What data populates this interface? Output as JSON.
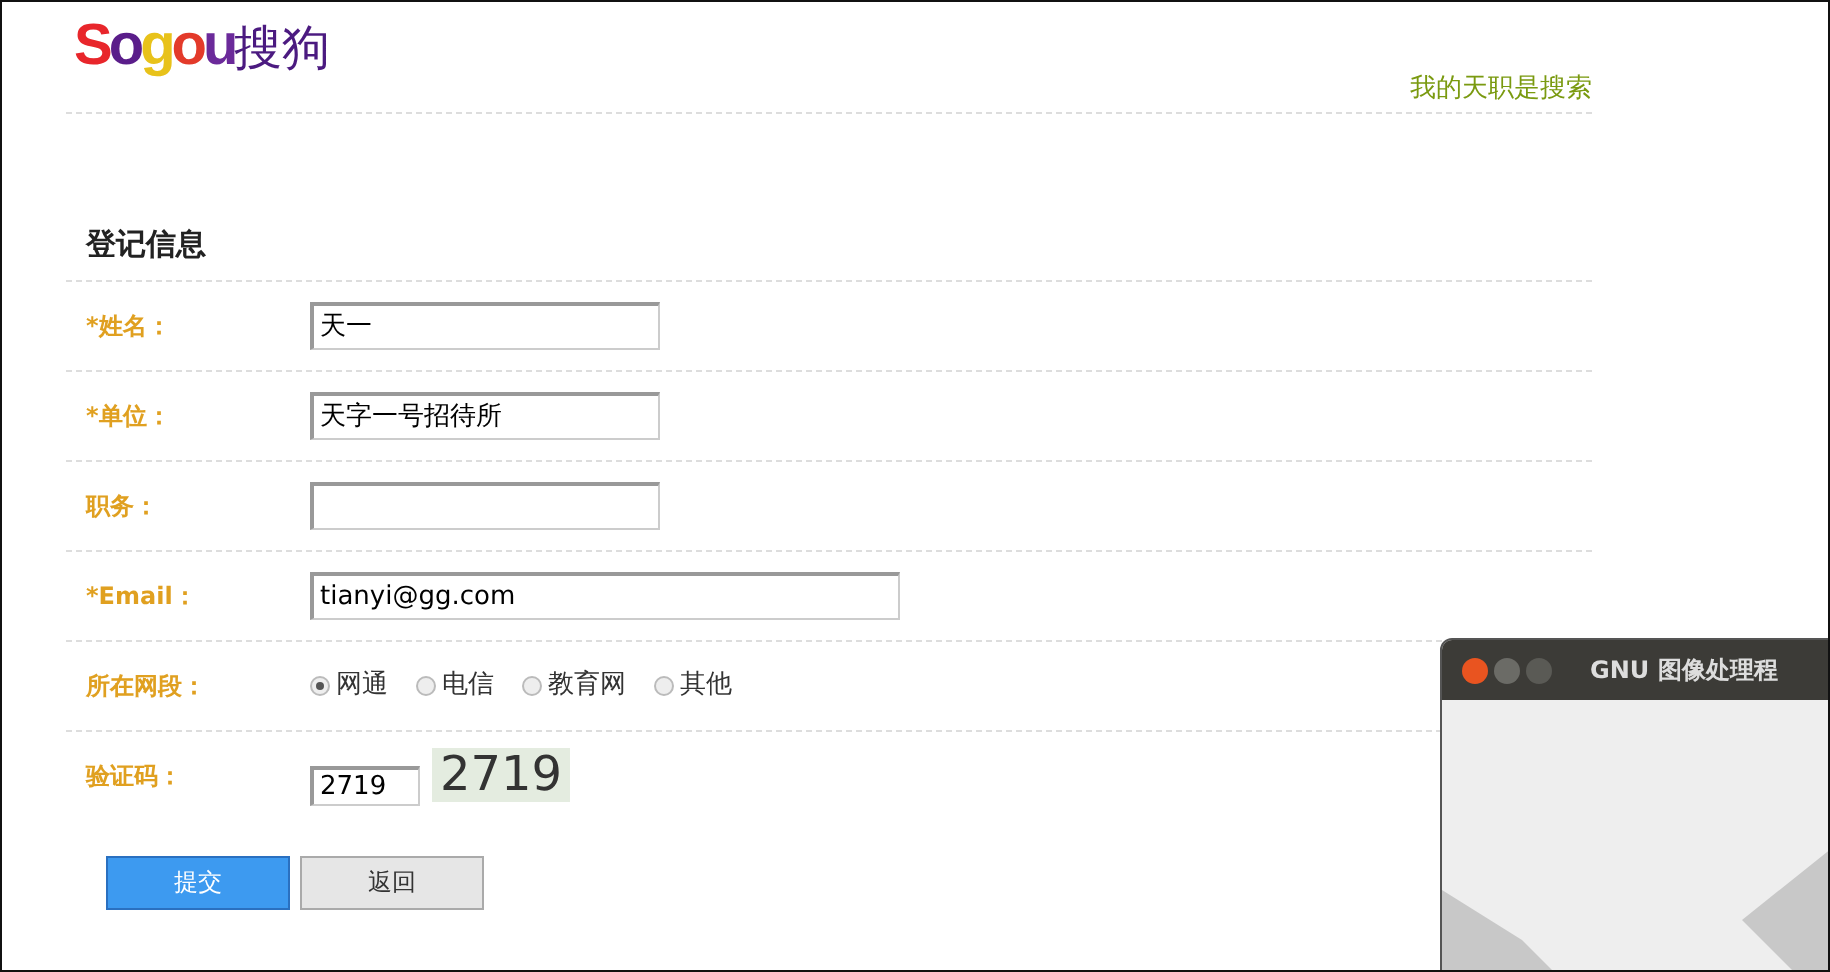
{
  "header": {
    "logo_latin": "Sogou",
    "logo_cjk": "搜狗",
    "slogan": "我的天职是搜索"
  },
  "form": {
    "title": "登记信息",
    "fields": [
      {
        "kind": "text",
        "label": "*姓名：",
        "value": "天一",
        "wide": false
      },
      {
        "kind": "text",
        "label": "*单位：",
        "value": "天字一号招待所",
        "wide": false
      },
      {
        "kind": "text",
        "label": "职务：",
        "wide": false
      },
      {
        "kind": "text",
        "label": "*Email：",
        "value": "tianyi@gg.com",
        "wide": true
      },
      {
        "kind": "radio",
        "label": "所在网段：",
        "options": [
          {
            "label": "网通",
            "selected": true
          },
          {
            "label": "电信",
            "selected": false
          },
          {
            "label": "教育网",
            "selected": false
          },
          {
            "label": "其他",
            "selected": false
          }
        ]
      },
      {
        "kind": "captcha",
        "label": "验证码：",
        "value": "2719",
        "code": "2719"
      }
    ],
    "buttons": [
      {
        "label": "提交",
        "primary": true
      },
      {
        "label": "返回",
        "primary": false
      }
    ]
  },
  "overlay_window": {
    "title": "GNU 图像处理程"
  }
}
